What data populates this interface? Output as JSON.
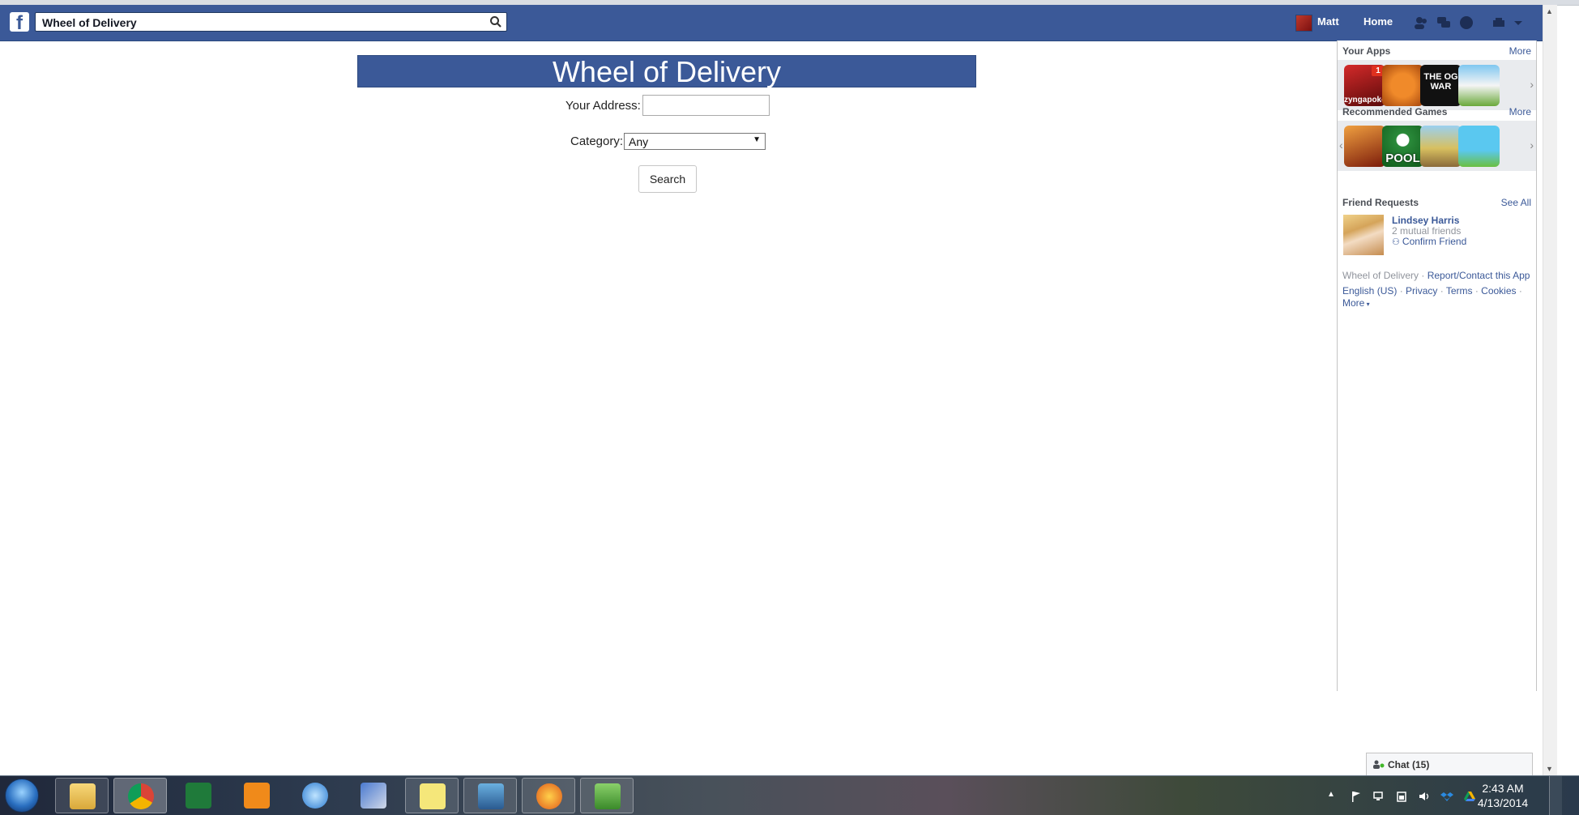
{
  "topbar": {
    "search_value": "Wheel of Delivery",
    "user_name": "Matt",
    "home_label": "Home"
  },
  "app": {
    "title": "Wheel of Delivery",
    "address_label": "Your Address:",
    "address_value": "",
    "category_label": "Category:",
    "category_value": "Any",
    "search_button": "Search"
  },
  "sidebar": {
    "your_apps": {
      "title": "Your Apps",
      "more": "More",
      "apps": [
        {
          "name": "zynga-poker",
          "caption": "zyngapoker",
          "badge": "1"
        },
        {
          "name": "basketball",
          "caption": ""
        },
        {
          "name": "the-og-war",
          "caption": "THE OG WAR"
        },
        {
          "name": "cow-game",
          "caption": ""
        }
      ]
    },
    "recommended_games": {
      "title": "Recommended Games",
      "more": "More",
      "games": [
        {
          "name": "warrior-game",
          "caption": ""
        },
        {
          "name": "pool",
          "caption": "POOL"
        },
        {
          "name": "runner-game",
          "caption": ""
        },
        {
          "name": "flappy-game",
          "caption": ""
        }
      ]
    },
    "friend_requests": {
      "title": "Friend Requests",
      "see_all": "See All",
      "name": "Lindsey Harris",
      "mutual": "2 mutual friends",
      "confirm": "Confirm Friend"
    },
    "footer": {
      "app_name": "Wheel of Delivery",
      "report": "Report/Contact this App",
      "language": "English (US)",
      "privacy": "Privacy",
      "terms": "Terms",
      "cookies": "Cookies",
      "more": "More"
    }
  },
  "chat": {
    "label": "Chat (15)"
  },
  "taskbar": {
    "time": "2:43 AM",
    "date": "4/13/2014"
  },
  "colors": {
    "facebook_blue": "#3b5998",
    "link_blue": "#3b5998"
  }
}
